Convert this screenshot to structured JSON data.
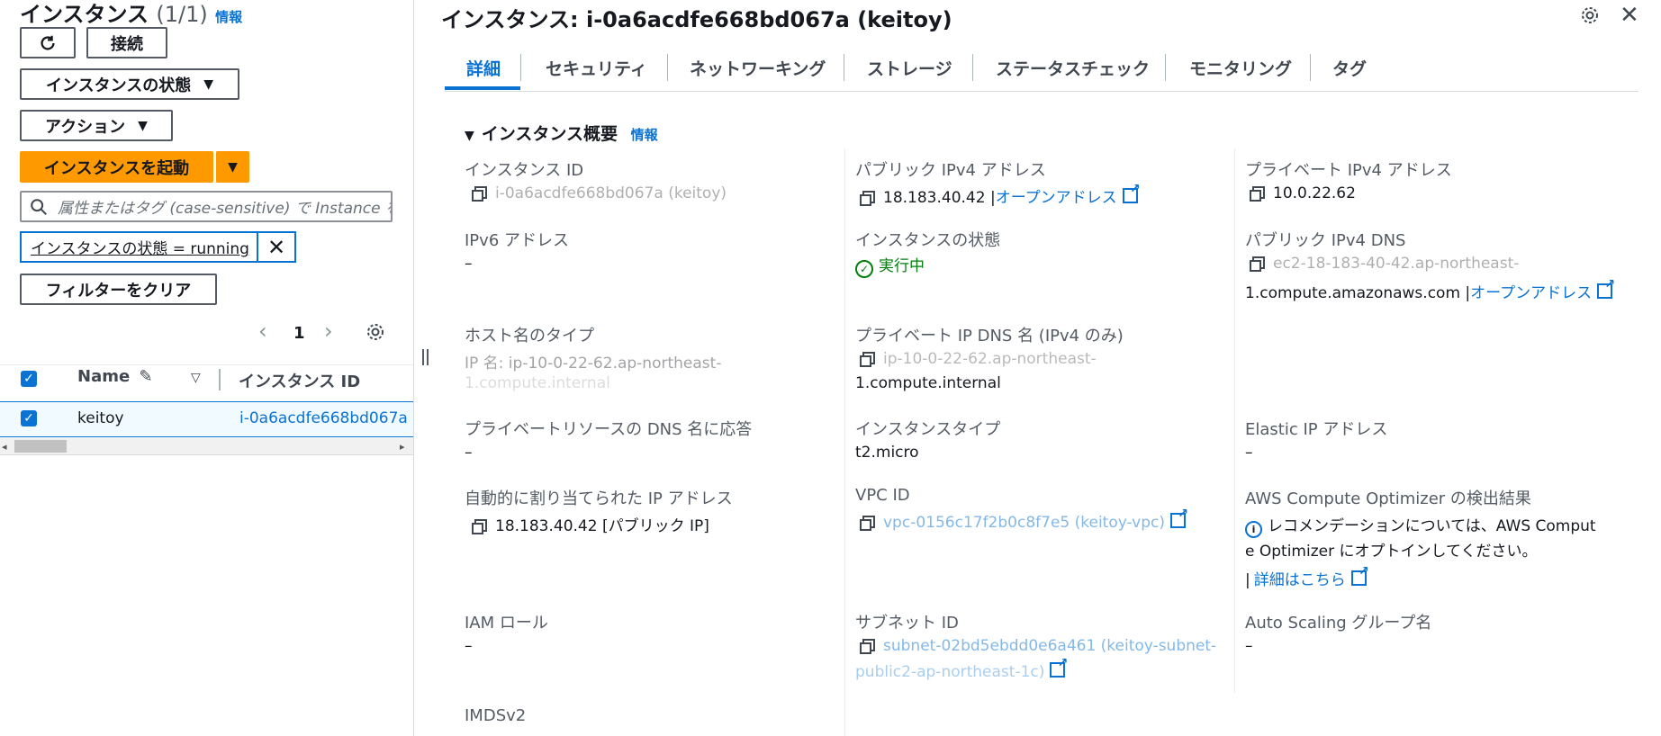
{
  "left": {
    "title": "インスタンス",
    "count": "(1/1)",
    "info": "情報",
    "refresh_icon": "refresh-icon",
    "connect": "接続",
    "instance_state": "インスタンスの状態",
    "actions": "アクション",
    "launch": "インスタンスを起動",
    "search_placeholder": "属性またはタグ (case-sensitive) で Instance を",
    "filter_token": "インスタンスの状態 = running",
    "clear_filters": "フィルターをクリア",
    "page_number": "1",
    "columns": {
      "name": "Name",
      "instance_id": "インスタンス ID"
    },
    "rows": [
      {
        "name": "keitoy",
        "instance_id": "i-0a6acdfe668bd067a"
      }
    ]
  },
  "right": {
    "title": "インスタンス: i-0a6acdfe668bd067a (keitoy)",
    "tabs": [
      "詳細",
      "セキュリティ",
      "ネットワーキング",
      "ストレージ",
      "ステータスチェック",
      "モニタリング",
      "タグ"
    ],
    "section_title": "インスタンス概要",
    "section_info": "情報",
    "fields": {
      "instance_id_label": "インスタンス ID",
      "instance_id_value": "i-0a6acdfe668bd067a (keitoy)",
      "public_ipv4_label": "パブリック IPv4 アドレス",
      "public_ipv4_value": "18.183.40.42",
      "open_address": "オープンアドレス",
      "private_ipv4_label": "プライベート IPv4 アドレス",
      "private_ipv4_value": "10.0.22.62",
      "ipv6_label": "IPv6 アドレス",
      "dash": "–",
      "state_label": "インスタンスの状態",
      "state_value": "実行中",
      "public_dns_label": "パブリック IPv4 DNS",
      "public_dns_line1": "ec2-18-183-40-42.ap-northeast-",
      "public_dns_line2": "1.compute.amazonaws.com",
      "hostname_type_label": "ホスト名のタイプ",
      "hostname_type_line1": "IP 名: ip-10-0-22-62.ap-northeast-",
      "hostname_type_line2": "1.compute.internal",
      "private_dns_label": "プライベート IP DNS 名 (IPv4 のみ)",
      "private_dns_line1": "ip-10-0-22-62.ap-northeast-",
      "private_dns_line2": "1.compute.internal",
      "private_resource_dns_label": "プライベートリソースの DNS 名に応答",
      "instance_type_label": "インスタンスタイプ",
      "instance_type_value": "t2.micro",
      "elastic_ip_label": "Elastic IP アドレス",
      "auto_ip_label": "自動的に割り当てられた IP アドレス",
      "auto_ip_value": "18.183.40.42 [パブリック IP]",
      "vpc_id_label": "VPC ID",
      "vpc_id_value": "vpc-0156c17f2b0c8f7e5 (keitoy-vpc)",
      "optimizer_label": "AWS Compute Optimizer の検出結果",
      "optimizer_line1": "レコメンデーションについては、AWS Comput",
      "optimizer_line2": "e Optimizer にオプトインしてください。",
      "optimizer_more": "詳細はこちら",
      "iam_role_label": "IAM ロール",
      "subnet_id_label": "サブネット ID",
      "subnet_line1": "subnet-02bd5ebdd0e6a461 (keitoy-subnet-",
      "subnet_line2": "public2-ap-northeast-1c)",
      "asg_label": "Auto Scaling グループ名",
      "imdsv2_label": "IMDSv2"
    }
  },
  "colors": {
    "primary": "#ff9900",
    "link": "#0972d3",
    "success": "#037f0c"
  }
}
